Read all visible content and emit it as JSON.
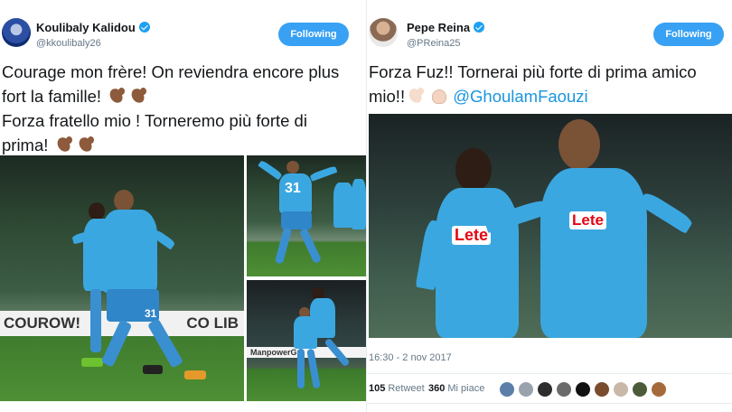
{
  "left_tweet": {
    "display_name": "Koulibaly Kalidou",
    "handle": "@kkoulibaly26",
    "follow_label": "Following",
    "text_lines": [
      "Courage mon frère! On reviendra encore plus",
      "fort la famille!",
      "Forza fratello mio ! Torneremo più forte di",
      "prima!"
    ],
    "photo_board_text": "COUROW!",
    "photo_board_text_2": "CO LIB",
    "photo_board_text_3": "ManpowerGr",
    "player_number": "31"
  },
  "right_tweet": {
    "display_name": "Pepe Reina",
    "handle": "@PReina25",
    "follow_label": "Following",
    "text_line_1": "Forza Fuz!! Tornerai più forte di prima amico",
    "text_line_2_prefix": "mio!!",
    "mention": "@GhoulamFaouzi",
    "timestamp": "16:30 - 2 nov 2017",
    "retweet_count": "105",
    "retweet_label": "Retweet",
    "like_count": "360",
    "like_label": "Mi piace",
    "sponsor_1": "Lete",
    "sponsor_2": "Lete"
  },
  "colors": {
    "follow_button": "#38a1f3",
    "verified": "#1da1f2",
    "mention": "#1b95e0",
    "napoli_blue": "#3ba7e0"
  },
  "liker_avatar_colors": [
    "#5b7fa8",
    "#9aa3ad",
    "#2d2d2d",
    "#6b6b6b",
    "#111111",
    "#7a4c2e",
    "#c9b8a8",
    "#4e5b3a",
    "#a56a3c"
  ]
}
